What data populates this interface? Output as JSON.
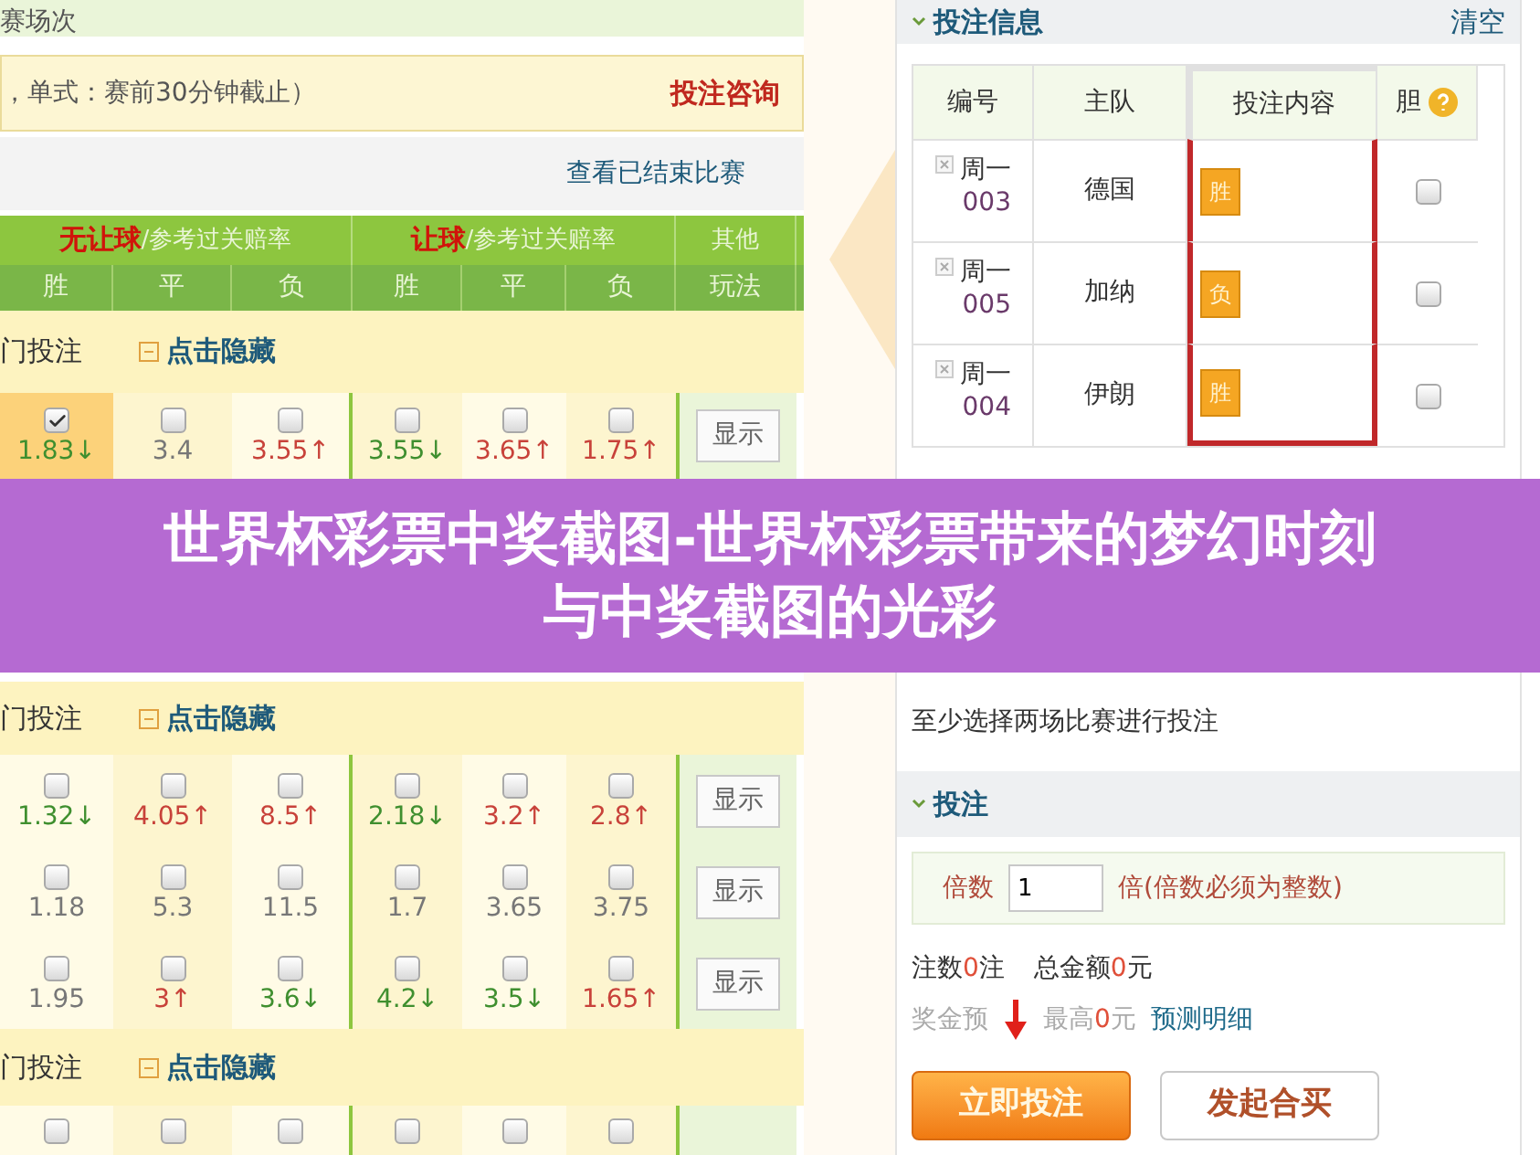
{
  "upper_left": {
    "title": "赛场次",
    "notice": "，单式：赛前30分钟截止）",
    "consult_link": "投注咨询",
    "ended_link": "查看已结束比赛",
    "header_groups": [
      "**无让球**/参考过关赔率",
      "**让球**/参考过关赔率",
      "其他"
    ],
    "header_columns": [
      "胜",
      "平",
      "负",
      "胜",
      "平",
      "负",
      "玩法"
    ],
    "section": {
      "label": "门投注",
      "toggle": "点击隐藏"
    },
    "rows": [
      {
        "cells": [
          {
            "odds": "1.83↓",
            "color": "#3f8f2f",
            "checked": true
          },
          {
            "odds": "3.4",
            "color": "#777777",
            "checked": false
          },
          {
            "odds": "3.55↑",
            "color": "#c8423a",
            "checked": false
          },
          {
            "odds": "3.55↓",
            "color": "#3f8f2f",
            "checked": false
          },
          {
            "odds": "3.65↑",
            "color": "#c8423a",
            "checked": false
          },
          {
            "odds": "1.75↑",
            "color": "#c8423a",
            "checked": false
          }
        ],
        "button": "显示"
      }
    ]
  },
  "upper_right": {
    "title": "投注信息",
    "clear": "清空",
    "columns": [
      "编号",
      "主队",
      "投注内容",
      "胆"
    ],
    "rows": [
      {
        "day": "周一",
        "number": "003",
        "team": "德国",
        "pick": "胜",
        "banker": false
      },
      {
        "day": "周一",
        "number": "005",
        "team": "加纳",
        "pick": "负",
        "banker": false
      },
      {
        "day": "周一",
        "number": "004",
        "team": "伊朗",
        "pick": "胜",
        "banker": false
      }
    ]
  },
  "title_banner": {
    "lines": [
      "世界杯彩票中奖截图-世界杯彩票带来的梦幻时刻",
      "与中奖截图的光彩"
    ]
  },
  "lower_left": {
    "sections": [
      {
        "label": "门投注",
        "toggle": "点击隐藏",
        "rows": [
          {
            "cells": [
              {
                "odds": "1.32↓",
                "color": "#3f8f2f",
                "checked": false
              },
              {
                "odds": "4.05↑",
                "color": "#c8423a",
                "checked": false
              },
              {
                "odds": "8.5↑",
                "color": "#c8423a",
                "checked": false
              },
              {
                "odds": "2.18↓",
                "color": "#3f8f2f",
                "checked": false
              },
              {
                "odds": "3.2↑",
                "color": "#c8423a",
                "checked": false
              },
              {
                "odds": "2.8↑",
                "color": "#c8423a",
                "checked": false
              }
            ],
            "button": "显示"
          },
          {
            "cells": [
              {
                "odds": "1.18",
                "color": "#777777",
                "checked": false
              },
              {
                "odds": "5.3",
                "color": "#777777",
                "checked": false
              },
              {
                "odds": "11.5",
                "color": "#777777",
                "checked": false
              },
              {
                "odds": "1.7",
                "color": "#777777",
                "checked": false
              },
              {
                "odds": "3.65",
                "color": "#777777",
                "checked": false
              },
              {
                "odds": "3.75",
                "color": "#777777",
                "checked": false
              }
            ],
            "button": "显示"
          },
          {
            "cells": [
              {
                "odds": "1.95",
                "color": "#777777",
                "checked": false
              },
              {
                "odds": "3↑",
                "color": "#c8423a",
                "checked": false
              },
              {
                "odds": "3.6↓",
                "color": "#3f8f2f",
                "checked": false
              },
              {
                "odds": "4.2↓",
                "color": "#3f8f2f",
                "checked": false
              },
              {
                "odds": "3.5↓",
                "color": "#3f8f2f",
                "checked": false
              },
              {
                "odds": "1.65↑",
                "color": "#c8423a",
                "checked": false
              }
            ],
            "button": "显示"
          }
        ]
      },
      {
        "label": "门投注",
        "toggle": "点击隐藏",
        "rows": [
          {
            "cells": [
              {
                "checked": false
              },
              {
                "checked": false
              },
              {
                "checked": false
              },
              {
                "checked": false
              },
              {
                "checked": false
              },
              {
                "checked": false
              }
            ]
          }
        ]
      }
    ]
  },
  "lower_right": {
    "hint": "至少选择两场比赛进行投注",
    "bet_title": "投注",
    "multiple_label": "倍数",
    "multiple_value": "1",
    "multiple_note": "倍(倍数必须为整数)",
    "count_label": "注数",
    "count_value": "0",
    "count_unit": "注",
    "total_label": "总金额",
    "total_value": "0",
    "total_unit": "元",
    "prize_label": "奖金预",
    "max_label": "最高",
    "max_value": "0",
    "max_unit": "元",
    "detail_link": "预测明细",
    "buttons": [
      {
        "label": "立即投注",
        "kind": "primary"
      },
      {
        "label": "发起合买",
        "kind": "secondary"
      }
    ]
  }
}
